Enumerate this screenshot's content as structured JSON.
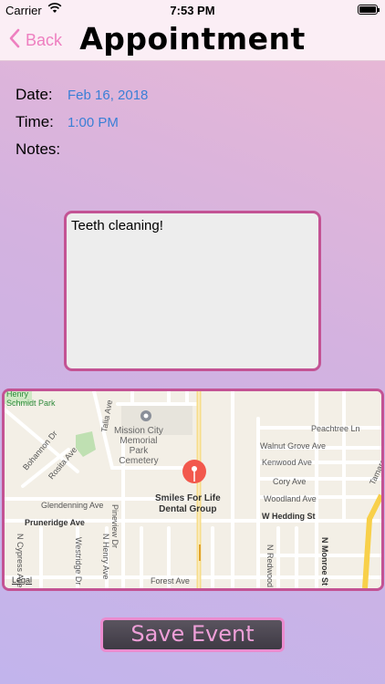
{
  "status_bar": {
    "carrier": "Carrier",
    "time": "7:53 PM",
    "icons": [
      "wifi-icon",
      "battery-icon"
    ]
  },
  "navbar": {
    "back_label": "Back",
    "title": "Appointment"
  },
  "form": {
    "date_label": "Date:",
    "date_value": "Feb 16, 2018",
    "time_label": "Time:",
    "time_value": "1:00 PM",
    "notes_label": "Notes:",
    "notes_text": "Teeth cleaning!"
  },
  "map": {
    "place_name": "Smiles For Life Dental Group",
    "place_name_line1": "Smiles For Life",
    "place_name_line2": "Dental Group",
    "poi_line1": "Mission City",
    "poi_line2": "Memorial",
    "poi_line3": "Park",
    "poi_line4": "Cemetery",
    "park_line1": "Henry",
    "park_line2": "Schmidt Park",
    "streets": {
      "peachtree": "Peachtree Ln",
      "walnut_grove": "Walnut Grove Ave",
      "kenwood": "Kenwood Ave",
      "cory": "Cory Ave",
      "woodland": "Woodland Ave",
      "w_hedding": "W Hedding St",
      "pruneridge": "Pruneridge Ave",
      "glendenning": "Glendenning Ave",
      "forest": "Forest Ave",
      "bohannon": "Bohannon Dr",
      "rosita": "Rosita Ave",
      "talia": "Talia Ave",
      "pineview": "Pineview Dr",
      "n_cypress": "N Cypress Ave",
      "westridge": "Westridge Dr",
      "n_henry": "N Henry Ave",
      "n_redwood": "N Redwood Ave",
      "n_monroe": "N Monroe St",
      "tamarack": "Tamarack"
    },
    "legal": "Legal",
    "pin_color": "#f2584c"
  },
  "save_button": {
    "label": "Save Event"
  },
  "colors": {
    "accent_pink": "#ee7fc0",
    "border_magenta": "#c35394",
    "link_blue": "#3a7fd6"
  }
}
